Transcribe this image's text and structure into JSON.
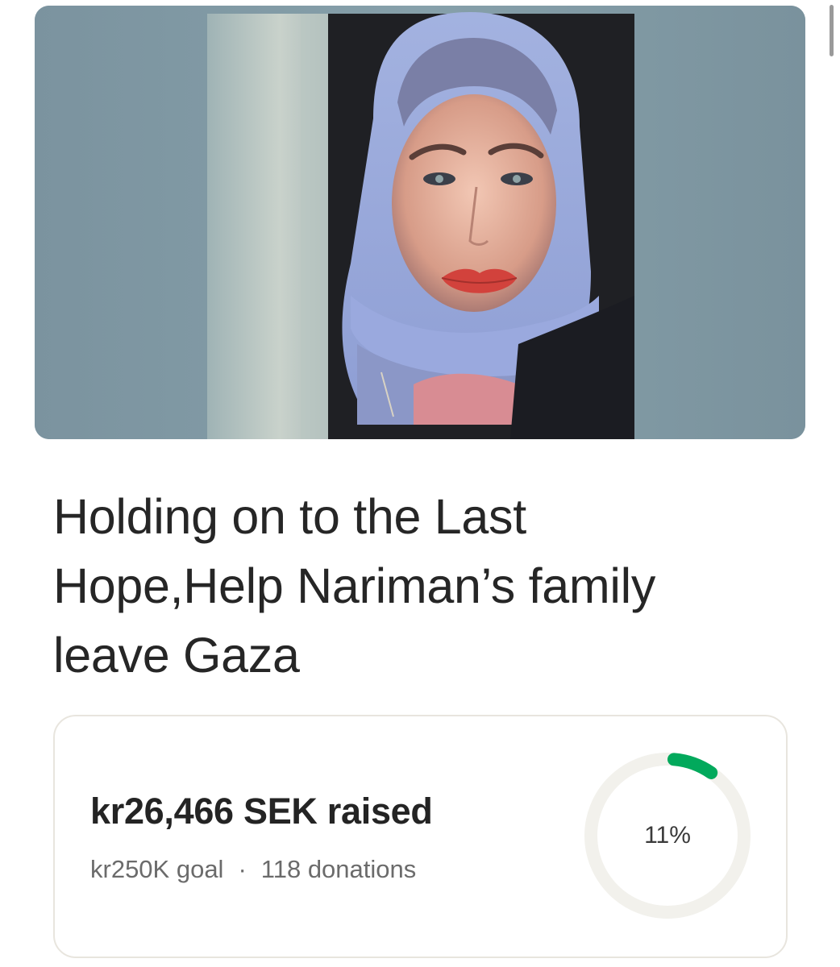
{
  "campaign": {
    "title": "Holding on to the Last Hope,Help Nariman’s family leave Gaza",
    "hero_image": "portrait-photo"
  },
  "stats": {
    "raised": "kr26,466 SEK raised",
    "goal": "kr250K goal",
    "separator": "·",
    "donations": "118 donations",
    "percent_label": "11%",
    "progress_fraction": 0.11
  },
  "colors": {
    "progress": "#02a95c",
    "ring_track": "#f2f1ec",
    "card_border": "#e8e5de"
  }
}
